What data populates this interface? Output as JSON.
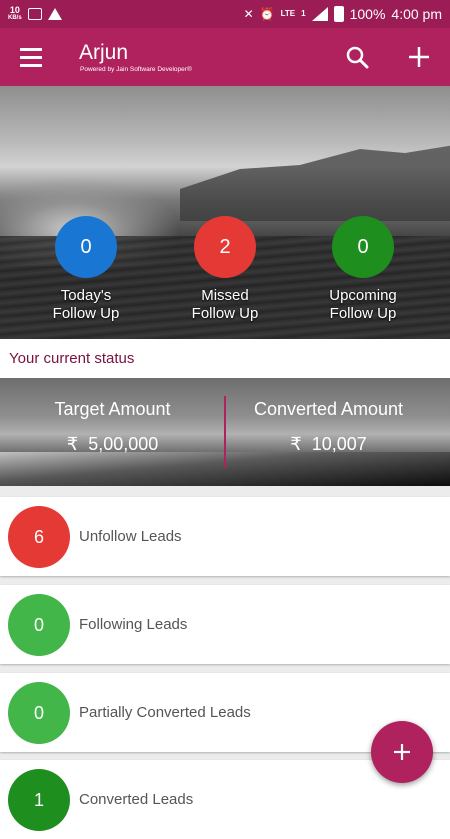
{
  "status_bar": {
    "speed_value": "10",
    "speed_unit": "KB/s",
    "network_label": "LTE",
    "sim_label": "1",
    "battery": "100%",
    "time": "4:00 pm"
  },
  "app_bar": {
    "title": "Arjun",
    "subtitle": "Powered by Jain Software Developer®",
    "icons": [
      "menu-icon",
      "search-icon",
      "plus-icon"
    ]
  },
  "follow_ups": [
    {
      "count": "0",
      "label_line1": "Today's",
      "label_line2": "Follow Up",
      "color": "#1976d2"
    },
    {
      "count": "2",
      "label_line1": "Missed",
      "label_line2": "Follow Up",
      "color": "#e53935"
    },
    {
      "count": "0",
      "label_line1": "Upcoming",
      "label_line2": "Follow Up",
      "color": "#1e8e1e"
    }
  ],
  "current_status": {
    "heading": "Your current status"
  },
  "amounts": {
    "target": {
      "title": "Target Amount",
      "currency": "₹",
      "value": "5,00,000"
    },
    "converted": {
      "title": "Converted Amount",
      "currency": "₹",
      "value": "10,007"
    }
  },
  "leads": [
    {
      "count": "6",
      "label": "Unfollow Leads",
      "color": "#e53935"
    },
    {
      "count": "0",
      "label": "Following Leads",
      "color": "#43b649"
    },
    {
      "count": "0",
      "label": "Partially Converted Leads",
      "color": "#43b649"
    },
    {
      "count": "1",
      "label": "Converted Leads",
      "color": "#1e8e1e"
    }
  ],
  "colors": {
    "primary": "#b0225e",
    "status_bar": "#9c1c55",
    "accent_text": "#7a1240"
  }
}
